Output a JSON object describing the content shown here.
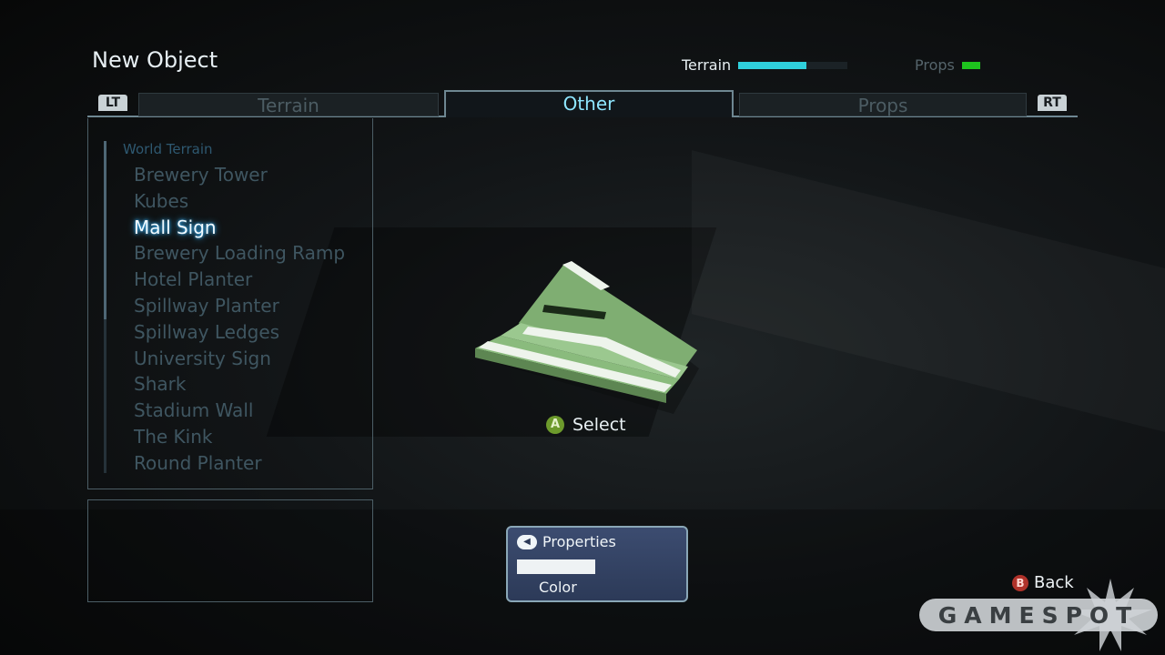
{
  "screen_title": "New Object",
  "meters": [
    {
      "label": "Terrain",
      "fill": 0.62,
      "color": "#2fd0dc"
    },
    {
      "label": "Props",
      "fill": 1.0,
      "color": "#1ec41e"
    }
  ],
  "bumpers": {
    "left": "LT",
    "right": "RT"
  },
  "tabs": [
    {
      "label": "Terrain",
      "active": false
    },
    {
      "label": "Other",
      "active": true
    },
    {
      "label": "Props",
      "active": false
    }
  ],
  "list": {
    "category": "World Terrain",
    "items": [
      "Brewery Tower",
      "Kubes",
      "Mall Sign",
      "Brewery Loading Ramp",
      "Hotel Planter",
      "Spillway Planter",
      "Spillway Ledges",
      "University Sign",
      "Shark",
      "Stadium Wall",
      "The Kink",
      "Round Planter"
    ],
    "selected_index": 2
  },
  "select_hint": {
    "button": "A",
    "label": "Select"
  },
  "properties": {
    "title": "Properties",
    "nav_icon": "dpad-left-icon",
    "color_label": "Color",
    "color_value": "#eef2f4"
  },
  "back_hint": {
    "button": "B",
    "label": "Back"
  },
  "watermark": "GAMESPOT",
  "colors": {
    "selection_glow": "#39b6ff",
    "active_tab_text": "#8ee6ff",
    "object_green": "#7fae72"
  }
}
